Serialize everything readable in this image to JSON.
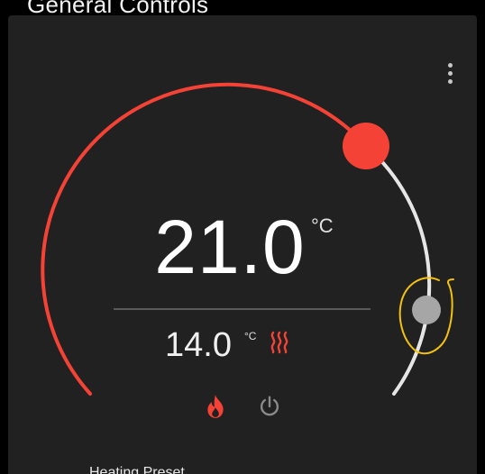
{
  "header": {
    "title": "General Controls"
  },
  "thermostat": {
    "target_temperature": "21.0",
    "target_unit": "°C",
    "current_temperature": "14.0",
    "current_unit": "°C",
    "action": "heating",
    "colors": {
      "heat": "#f44336",
      "track": "#e0e0e0",
      "low_handle": "#a6a6a6",
      "annotation": "#f4c20d"
    },
    "modes": [
      {
        "name": "heat",
        "icon": "flame-icon",
        "active": true
      },
      {
        "name": "off",
        "icon": "power-icon",
        "active": false
      }
    ],
    "preset_label": "Heating Preset"
  },
  "card": {
    "menu_icon": "more-vert-icon"
  }
}
